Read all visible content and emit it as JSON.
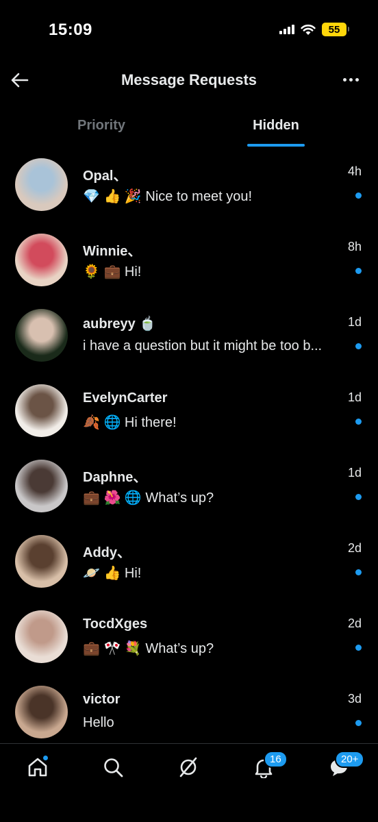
{
  "status_bar": {
    "time": "15:09",
    "battery": "55"
  },
  "header": {
    "title": "Message Requests"
  },
  "tabs": [
    {
      "label": "Priority",
      "active": false
    },
    {
      "label": "Hidden",
      "active": true
    }
  ],
  "requests": [
    {
      "name": "Opal、",
      "preview": "💎 👍 🎉 Nice to meet you!",
      "time": "4h",
      "unread": true,
      "avatar_colors": [
        "#d9c9bd",
        "#a9c3d8"
      ]
    },
    {
      "name": "Winnie、",
      "preview": "🌻 💼 Hi!",
      "time": "8h",
      "unread": true,
      "avatar_colors": [
        "#e8d3c4",
        "#d24b5c"
      ]
    },
    {
      "name": "aubreyy 🍵",
      "preview": "i have a question but it might be too b...",
      "time": "1d",
      "unread": true,
      "avatar_colors": [
        "#1a2a1a",
        "#d8c0b0"
      ]
    },
    {
      "name": "EvelynCarter",
      "preview": "🍂 🌐 Hi there!",
      "time": "1d",
      "unread": true,
      "avatar_colors": [
        "#f1ede8",
        "#6b5446"
      ]
    },
    {
      "name": "Daphne、",
      "preview": "💼 🌺 🌐 What’s up?",
      "time": "1d",
      "unread": true,
      "avatar_colors": [
        "#c9c7c8",
        "#4a3a35"
      ]
    },
    {
      "name": "Addy、",
      "preview": "🪐 👍 Hi!",
      "time": "2d",
      "unread": true,
      "avatar_colors": [
        "#d8bfa8",
        "#5a4030"
      ]
    },
    {
      "name": "TocdXges",
      "preview": "💼 🎌 💐 What’s up?",
      "time": "2d",
      "unread": true,
      "avatar_colors": [
        "#e9ddd5",
        "#c09a8a"
      ]
    },
    {
      "name": "victor",
      "preview": "Hello",
      "time": "3d",
      "unread": true,
      "avatar_colors": [
        "#c9a890",
        "#4a3428"
      ]
    }
  ],
  "bottom_nav": {
    "notifications_badge": "16",
    "messages_badge": "20+"
  },
  "colors": {
    "accent": "#1d9bf0",
    "background": "#000000",
    "text": "#e7e9ea",
    "muted": "#71767b"
  }
}
